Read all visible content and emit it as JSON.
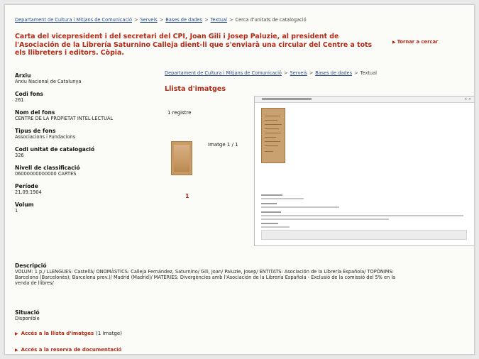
{
  "breadcrumb_top": {
    "items": [
      "Departament de Cultura i Mitjans de Comunicació",
      "Serveis",
      "Bases de dades",
      "Textual"
    ],
    "current": "Cerca d'unitats de catalogació",
    "separator": ">"
  },
  "record": {
    "title": "Carta del vicepresident i del secretari del CPI, Joan Gili i Josep Paluzie, al president de l'Asociación de la Librería Saturnino Calleja dient-li que s'enviarà una circular del Centre a tots els llibreters i editors. Còpia.",
    "back_link": "Tornar a cercar",
    "back_icon": "arrow-right-icon"
  },
  "fields": [
    {
      "label": "Arxiu",
      "value": "Arxiu Nacional de Catalunya"
    },
    {
      "label": "Codi fons",
      "value": "261"
    },
    {
      "label": "Nom del fons",
      "value": "CENTRE DE LA PROPIETAT INTEL·LECTUAL"
    },
    {
      "label": "Tipus de fons",
      "value": "Associacions i Fundacions"
    },
    {
      "label": "Codi unitat de catalogació",
      "value": "326"
    },
    {
      "label": "Nivell de classificació",
      "value": "06000000000000 CARTES"
    },
    {
      "label": "Període",
      "value": "21.09.1904"
    },
    {
      "label": "Volum",
      "value": "1"
    }
  ],
  "breadcrumb_inner": {
    "items": [
      "Departament de Cultura i Mitjans de Comunicació",
      "Serveis",
      "Bases de dades"
    ],
    "current": "Textual",
    "separator": ">"
  },
  "image_list": {
    "heading": "Llista d'imatges",
    "records": "1 registre",
    "image_count": "Imatge 1 / 1",
    "page_number": "1"
  },
  "description": {
    "label": "Descripció",
    "value": "VOLUM: 1 p./ LLENGUES: Castellà/ ONOMÀSTICS: Calleja Fernández, Saturnino/ Gili, Joan/ Paluzie, Josep/ ENTITATS: Asociación de la Librería Española/ TOPÒNIMS: Barcelona (Barcelonès); Barcelona prov.)/ Madrid (Madrid)/ MATÈRIES: Divergències amb l'Asociación de la Librería Española - Exclusió de la comissió del 5% en la venda de llibres/"
  },
  "situation": {
    "label": "Situació",
    "value": "Disponible"
  },
  "access_links": [
    {
      "label": "Accés a la llista d'imatges",
      "extra": "(1 Imatge)"
    },
    {
      "label": "Accés a la reserva de documentació",
      "extra": ""
    }
  ],
  "colors": {
    "accent": "#b22a16",
    "link": "#2a4b8d"
  }
}
